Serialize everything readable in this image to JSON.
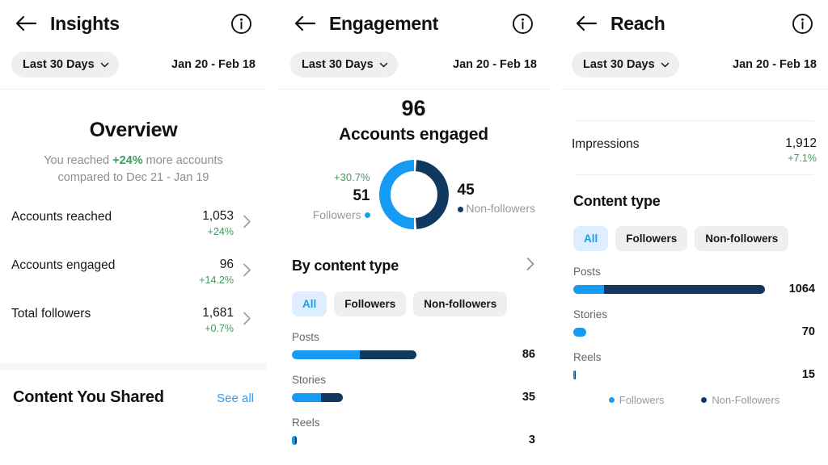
{
  "colors": {
    "followers": "#159bf3",
    "non_followers": "#11395f",
    "positive": "#3f9a5f",
    "link": "#2b9df4",
    "active_pill_bg": "#ddeeff",
    "pill_bg": "#efefef"
  },
  "insights": {
    "title": "Insights",
    "back_icon": "back-arrow-icon",
    "info_icon": "info-circle-icon",
    "range_pill": "Last 30 Days",
    "date_range": "Jan 20 - Feb 18",
    "overview_title": "Overview",
    "overview_sub_pre": "You reached ",
    "overview_sub_pct": "+24%",
    "overview_sub_post": " more accounts",
    "overview_sub_line2": "compared to Dec 21 - Jan 19",
    "metrics": [
      {
        "label": "Accounts reached",
        "value": "1,053",
        "delta": "+24%"
      },
      {
        "label": "Accounts engaged",
        "value": "96",
        "delta": "+14.2%"
      },
      {
        "label": "Total followers",
        "value": "1,681",
        "delta": "+0.7%"
      }
    ],
    "shared_title": "Content You Shared",
    "see_all": "See all"
  },
  "engagement": {
    "title": "Engagement",
    "back_icon": "back-arrow-icon",
    "info_icon": "info-circle-icon",
    "range_pill": "Last 30 Days",
    "date_range": "Jan 20 - Feb 18",
    "big_value": "96",
    "big_label": "Accounts engaged",
    "donut": {
      "followers_delta": "+30.7%",
      "followers_value": "51",
      "followers_label": "Followers",
      "non_followers_value": "45",
      "non_followers_label": "Non-followers"
    },
    "section_title": "By content type",
    "tabs": [
      "All",
      "Followers",
      "Non-followers"
    ],
    "active_tab": "All"
  },
  "reach": {
    "title": "Reach",
    "back_icon": "back-arrow-icon",
    "info_icon": "info-circle-icon",
    "range_pill": "Last 30 Days",
    "date_range": "Jan 20 - Feb 18",
    "impressions_label": "Impressions",
    "impressions_value": "1,912",
    "impressions_delta": "+7.1%",
    "section_title": "Content type",
    "tabs": [
      "All",
      "Followers",
      "Non-followers"
    ],
    "active_tab": "All",
    "legend": [
      "Followers",
      "Non-Followers"
    ]
  },
  "chart_data": [
    {
      "type": "pie",
      "title": "Accounts engaged",
      "total": 96,
      "categories": [
        "Followers",
        "Non-followers"
      ],
      "values": [
        51,
        45
      ],
      "colors": [
        "#159bf3",
        "#11395f"
      ],
      "legend": "sides",
      "annotations": [
        "+30.7%"
      ]
    },
    {
      "type": "bar",
      "title": "By content type",
      "orientation": "horizontal",
      "stacked": true,
      "categories": [
        "Posts",
        "Stories",
        "Reels"
      ],
      "totals": [
        86,
        35,
        3
      ],
      "series": [
        {
          "name": "Followers",
          "values": [
            47,
            20,
            2
          ],
          "color": "#159bf3"
        },
        {
          "name": "Non-followers",
          "values": [
            39,
            15,
            1
          ],
          "color": "#11395f"
        }
      ],
      "max_total": 86,
      "grid": false,
      "legend": "none"
    },
    {
      "type": "bar",
      "title": "Content type",
      "orientation": "horizontal",
      "stacked": true,
      "categories": [
        "Posts",
        "Stories",
        "Reels"
      ],
      "totals": [
        1064,
        70,
        15
      ],
      "series": [
        {
          "name": "Followers",
          "values": [
            172,
            70,
            10
          ],
          "color": "#159bf3"
        },
        {
          "name": "Non-Followers",
          "values": [
            892,
            0,
            5
          ],
          "color": "#11395f"
        }
      ],
      "max_total": 1064,
      "grid": false,
      "legend": "bottom"
    }
  ]
}
